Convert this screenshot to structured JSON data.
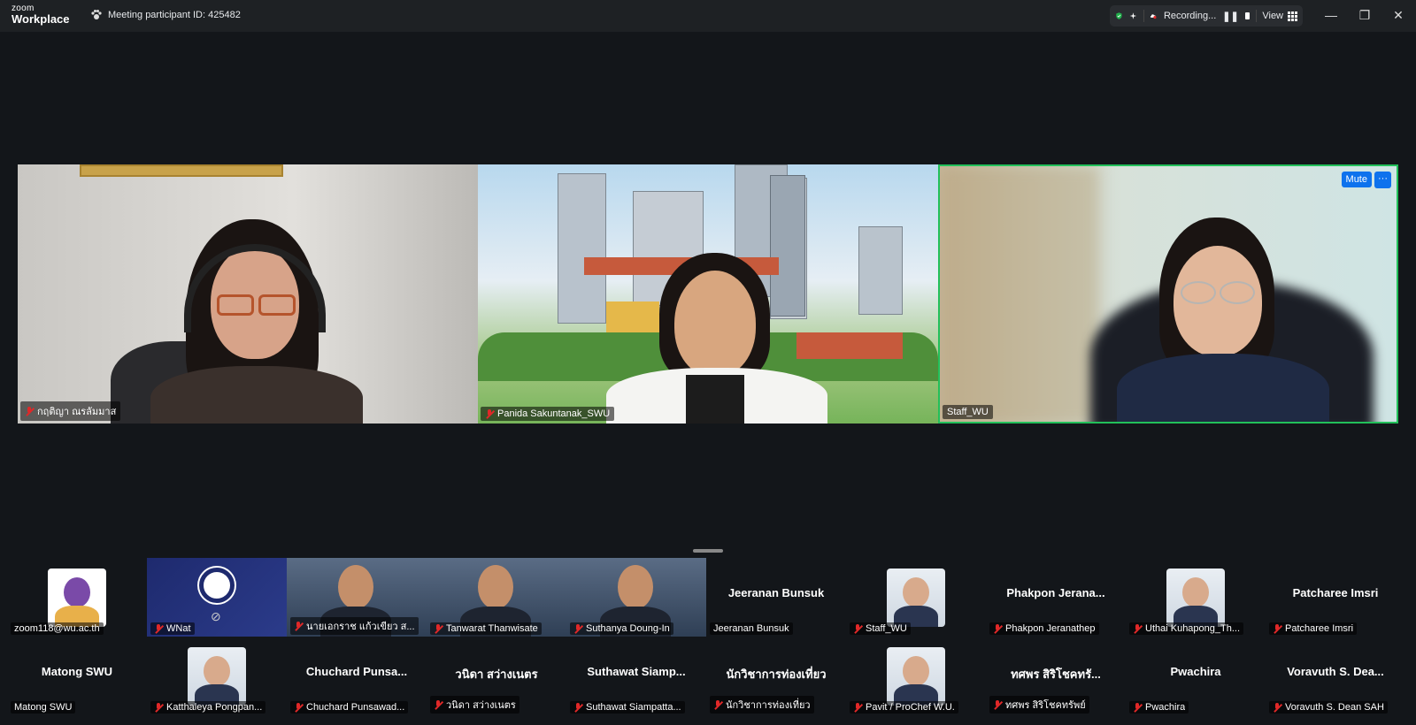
{
  "app": {
    "logo_top": "zoom",
    "logo_bottom": "Workplace",
    "meeting_id": "Meeting participant ID: 425482",
    "recording_label": "Recording...",
    "view_label": "View"
  },
  "main_tiles": [
    {
      "name": "กฤติญา ณรลัมมาส",
      "muted": true,
      "bg": "#d9d6d1"
    },
    {
      "name": "Panida Sakuntanak_SWU",
      "muted": true,
      "bg": "#a8c9e6"
    },
    {
      "name": "Staff_WU",
      "muted": false,
      "bg": "#cfe0da",
      "active_speaker": true,
      "mute_button": "Mute",
      "more_button": "···"
    }
  ],
  "gallery_row1": [
    {
      "display": "",
      "tag": "zoom118@wu.ac.th",
      "muted": false,
      "kind": "logo"
    },
    {
      "display": "",
      "tag": "WNat",
      "muted": true,
      "kind": "obs"
    },
    {
      "display": "",
      "tag": "นายเอกราช แก้วเขียว ส...",
      "muted": true,
      "kind": "video"
    },
    {
      "display": "",
      "tag": "Tanwarat Thanwisate",
      "muted": true,
      "kind": "video"
    },
    {
      "display": "",
      "tag": "Suthanya Doung-In",
      "muted": true,
      "kind": "video"
    },
    {
      "display": "Jeeranan Bunsuk",
      "tag": "Jeeranan Bunsuk",
      "muted": false,
      "kind": "name"
    },
    {
      "display": "",
      "tag": "Staff_WU",
      "muted": true,
      "kind": "photo"
    },
    {
      "display": "Phakpon  Jerana...",
      "tag": "Phakpon Jeranathep",
      "muted": true,
      "kind": "name"
    },
    {
      "display": "",
      "tag": "Uthai Kuhapong_Th...",
      "muted": true,
      "kind": "photo"
    },
    {
      "display": "Patcharee Imsri",
      "tag": "Patcharee Imsri",
      "muted": true,
      "kind": "name"
    }
  ],
  "gallery_row2": [
    {
      "display": "Matong SWU",
      "tag": "Matong SWU",
      "muted": false,
      "kind": "name"
    },
    {
      "display": "",
      "tag": "Katthaleya Pongpan...",
      "muted": true,
      "kind": "photo"
    },
    {
      "display": "Chuchard  Punsa...",
      "tag": "Chuchard Punsawad...",
      "muted": true,
      "kind": "name"
    },
    {
      "display": "วนิดา สว่างเนตร",
      "tag": "วนิดา สว่างเนตร",
      "muted": true,
      "kind": "name"
    },
    {
      "display": "Suthawat  Siamp...",
      "tag": "Suthawat Siampatta...",
      "muted": true,
      "kind": "name"
    },
    {
      "display": "นักวิชาการท่องเที่ยว",
      "tag": "นักวิชาการท่องเที่ยว",
      "muted": true,
      "kind": "name"
    },
    {
      "display": "",
      "tag": "Pavit / ProChef W.U.",
      "muted": true,
      "kind": "photo"
    },
    {
      "display": "ทศพร  สิริโชคทรั...",
      "tag": "ทศพร  สิริโชคทรัพย์",
      "muted": true,
      "kind": "name"
    },
    {
      "display": "Pwachira",
      "tag": "Pwachira",
      "muted": true,
      "kind": "name"
    },
    {
      "display": "Voravuth  S. Dea...",
      "tag": "Voravuth S. Dean SAH",
      "muted": true,
      "kind": "name"
    }
  ]
}
